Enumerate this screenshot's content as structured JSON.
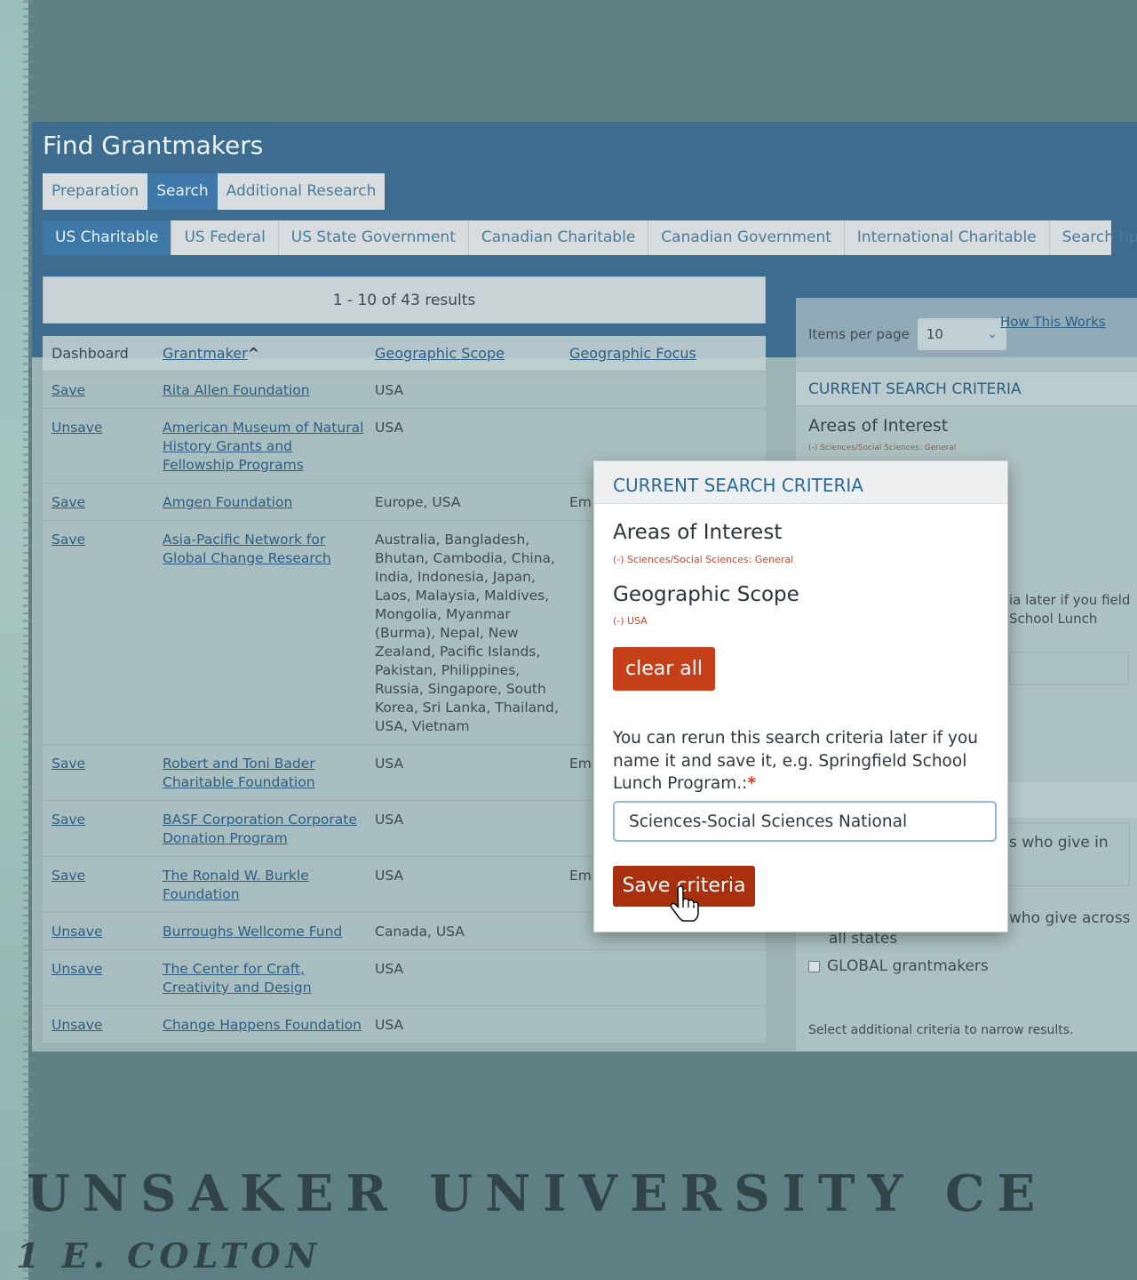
{
  "campus": {
    "sign_line1": "UNSAKER UNIVERSITY CE",
    "sign_line2": "1 E. COLTON"
  },
  "page": {
    "title": "Find Grantmakers",
    "subnav": [
      "Preparation",
      "Search",
      "Additional Research"
    ],
    "subnav_active": 1,
    "tabs": [
      "US Charitable",
      "US Federal",
      "US State Government",
      "Canadian Charitable",
      "Canadian Government",
      "International Charitable",
      "Search tips"
    ],
    "tabs_active": 0,
    "results_summary": "1 - 10 of 43 results"
  },
  "table": {
    "headers": [
      "Dashboard",
      "Grantmaker",
      "Geographic Scope",
      "Geographic Focus"
    ],
    "sort_indicator": "^",
    "rows": [
      {
        "action": "Save",
        "name": "Rita Allen Foundation",
        "scope": "USA",
        "focus": ""
      },
      {
        "action": "Unsave",
        "name": "American Museum of Natural History Grants and Fellowship Programs",
        "scope": "USA",
        "focus": ""
      },
      {
        "action": "Save",
        "name": "Amgen Foundation",
        "scope": "Europe, USA",
        "focus": "Em wi"
      },
      {
        "action": "Save",
        "name": "Asia-Pacific Network for Global Change Research",
        "scope": "Australia, Bangladesh, Bhutan, Cambodia, China, India, Indonesia, Japan, Laos, Malaysia, Maldives, Mongolia, Myanmar (Burma), Nepal, New Zealand, Pacific Islands, Pakistan, Philippines, Russia, Singapore, South Korea, Sri Lanka, Thailand, USA, Vietnam",
        "focus": ""
      },
      {
        "action": "Save",
        "name": "Robert and Toni Bader Charitable Foundation",
        "scope": "USA",
        "focus": "Em IN"
      },
      {
        "action": "Save",
        "name": "BASF Corporation Corporate Donation Program",
        "scope": "USA",
        "focus": ""
      },
      {
        "action": "Save",
        "name": "The Ronald W. Burkle Foundation",
        "scope": "USA",
        "focus": "Em CA"
      },
      {
        "action": "Unsave",
        "name": "Burroughs Wellcome Fund",
        "scope": "Canada, USA",
        "focus": ""
      },
      {
        "action": "Unsave",
        "name": "The Center for Craft, Creativity and Design",
        "scope": "USA",
        "focus": ""
      },
      {
        "action": "Unsave",
        "name": "Change Happens Foundation",
        "scope": "USA",
        "focus": ""
      }
    ]
  },
  "sidebar": {
    "items_per_page_label": "Items per page",
    "items_per_page_value": "10",
    "how_this_works": "How This Works",
    "heading": "CURRENT SEARCH CRITERIA",
    "areas_label": "Areas of Interest",
    "areas_tag": "(-) Sciences/Social Sciences: General",
    "partial_help": "ia later if you field School Lunch",
    "partial_give_in": "s who give in",
    "partial_give_across": "who give across",
    "all_states": "all states",
    "global": "GLOBAL grantmakers",
    "select_more": "Select additional criteria to narrow results."
  },
  "popup": {
    "heading": "CURRENT SEARCH CRITERIA",
    "areas_label": "Areas of Interest",
    "areas_tag": "(-) Sciences/Social Sciences: General",
    "scope_label": "Geographic Scope",
    "scope_tag": "(-) USA",
    "clear_label": "clear all",
    "help_text": "You can rerun this search criteria later if you name it and save it, e.g. Springfield School Lunch Program.:",
    "required_mark": "*",
    "name_value": "Sciences-Social Sciences National",
    "save_label": "Save criteria"
  },
  "colors": {
    "accent_blue": "#2b6a96",
    "button_red": "#c53f18",
    "save_red": "#a8300e"
  }
}
